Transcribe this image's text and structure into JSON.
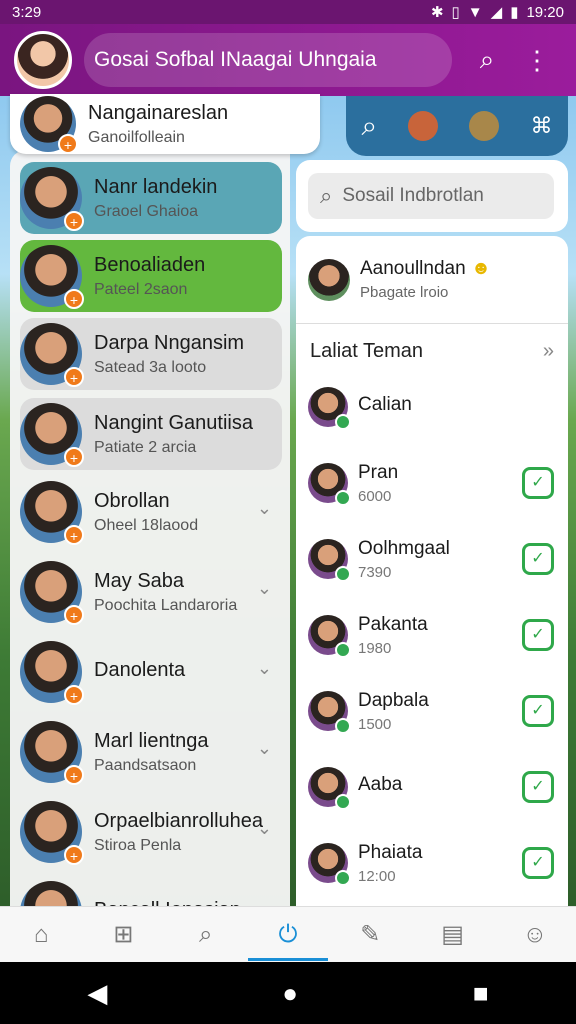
{
  "status_bar": {
    "time_left": "3:29",
    "time_right": "19:20"
  },
  "app_bar": {
    "title": "Gosai Sofbal INaagai Uhngaia"
  },
  "top_card": {
    "name": "Nangainareslan",
    "sub": "Ganoilfolleain"
  },
  "contacts": [
    {
      "name": "Nanr landekin",
      "sub": "Graoel Ghaioa",
      "bg": "#5aa6b5"
    },
    {
      "name": "Benoaliaden",
      "sub": "Pateel 2saon",
      "bg": "#63b83e"
    },
    {
      "name": "Darpa Nngansim",
      "sub": "Satead 3a looto",
      "bg": "#dcdcdc"
    },
    {
      "name": "Nangint Ganutiisa",
      "sub": "Patiate 2 arcia",
      "bg": "#dcdcdc"
    },
    {
      "name": "Obrollan",
      "sub": "Oheel 18laood",
      "bg": "transparent"
    },
    {
      "name": "May Saba",
      "sub": "Poochita Landaroria",
      "bg": "transparent"
    },
    {
      "name": "Danolenta",
      "sub": "",
      "bg": "transparent"
    },
    {
      "name": "Marl lientnga",
      "sub": "Paandsatsaon",
      "bg": "transparent"
    },
    {
      "name": "Orpaelbianrolluhea",
      "sub": "Stiroa Penla",
      "bg": "transparent"
    },
    {
      "name": "Bancall Ionasian",
      "sub": "",
      "bg": "transparent"
    }
  ],
  "right": {
    "search_placeholder": "Sosail Indbrotlan",
    "featured": {
      "name": "Aanoullndan",
      "sub": "Pbagate lroio"
    },
    "section_title": "Laliat Teman",
    "friends": [
      {
        "name": "Calian",
        "sub": ""
      },
      {
        "name": "Pran",
        "sub": "6000"
      },
      {
        "name": "Oolhmgaal",
        "sub": "7390"
      },
      {
        "name": "Pakanta",
        "sub": "1980"
      },
      {
        "name": "Dapbala",
        "sub": "1500"
      },
      {
        "name": "Aaba",
        "sub": ""
      },
      {
        "name": "Phaiata",
        "sub": "12:00"
      }
    ]
  }
}
